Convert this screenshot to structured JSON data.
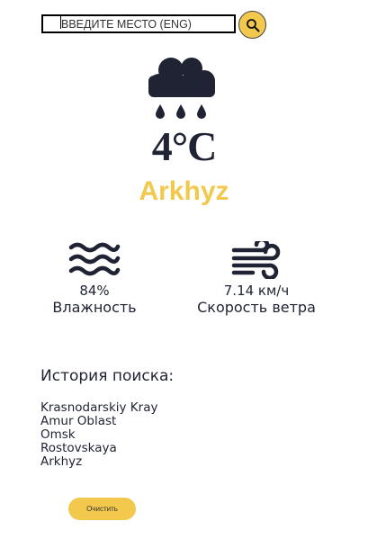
{
  "search": {
    "placeholder": "ВВЕДИТЕ МЕСТО (ENG)",
    "value": ""
  },
  "weather": {
    "temperature": "4°C",
    "city": "Arkhyz",
    "condition_icon": "cloud-rain-icon",
    "humidity": {
      "value": "84%",
      "label": "Влажность",
      "icon": "water-waves-icon"
    },
    "wind": {
      "value": "7.14 км/ч",
      "label": "Скорость ветра",
      "icon": "wind-icon"
    }
  },
  "history": {
    "title": "История поиска:",
    "items": [
      "Krasnodarskiy Kray",
      "Amur Oblast",
      "Omsk",
      "Rostovskaya",
      "Arkhyz"
    ]
  },
  "clear_button": {
    "label": "Очистить"
  },
  "colors": {
    "accent": "#f2c94c",
    "text": "#1f2333"
  }
}
